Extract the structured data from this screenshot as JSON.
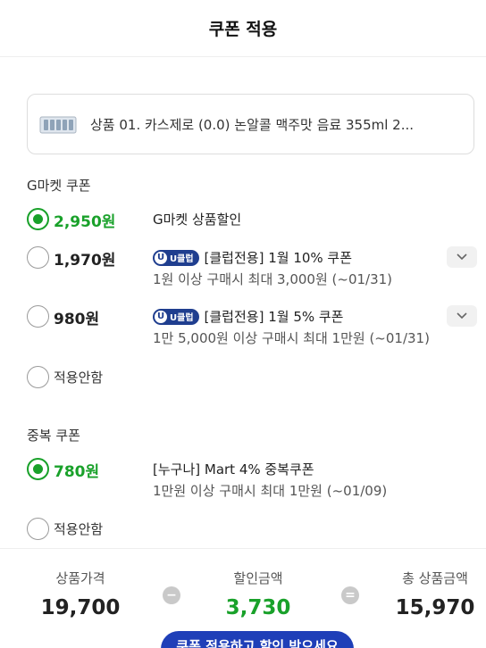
{
  "header": {
    "title": "쿠폰 적용"
  },
  "product": {
    "name": "상품 01. 카스제로 (0.0) 논알콜 맥주맛 음료 355ml 2..."
  },
  "gmarket_section": {
    "title": "G마켓 쿠폰",
    "coupons": [
      {
        "amount": "2,950원",
        "name": "G마켓 상품할인",
        "condition": "",
        "selected": true,
        "uclub": false
      },
      {
        "amount": "1,970원",
        "badge": "U클럽",
        "name": "[클럽전용] 1월 10% 쿠폰",
        "condition": "1원 이상 구매시 최대 3,000원 (~01/31)",
        "selected": false,
        "uclub": true
      },
      {
        "amount": "980원",
        "badge": "U클럽",
        "name": "[클럽전용] 1월 5% 쿠폰",
        "condition": "1만 5,000원 이상 구매시 최대 1만원 (~01/31)",
        "selected": false,
        "uclub": true
      }
    ],
    "none_label": "적용안함"
  },
  "duplicate_section": {
    "title": "중복 쿠폰",
    "coupons": [
      {
        "amount": "780원",
        "name": "[누구나] Mart 4% 중복쿠폰",
        "condition": "1만원 이상 구매시 최대 1만원 (~01/09)",
        "selected": true
      }
    ],
    "none_label": "적용안함"
  },
  "summary": {
    "price_label": "상품가격",
    "price_value": "19,700",
    "minus": "−",
    "discount_label": "할인금액",
    "discount_value": "3,730",
    "equals": "=",
    "total_label": "총 상품금액",
    "total_value": "15,970"
  },
  "apply_button": "쿠폰 적용하고 할인 받으세요",
  "colors": {
    "accent_green": "#19a12a",
    "uclub_navy": "#1f3e8f",
    "button_blue": "#1f3fb8"
  }
}
